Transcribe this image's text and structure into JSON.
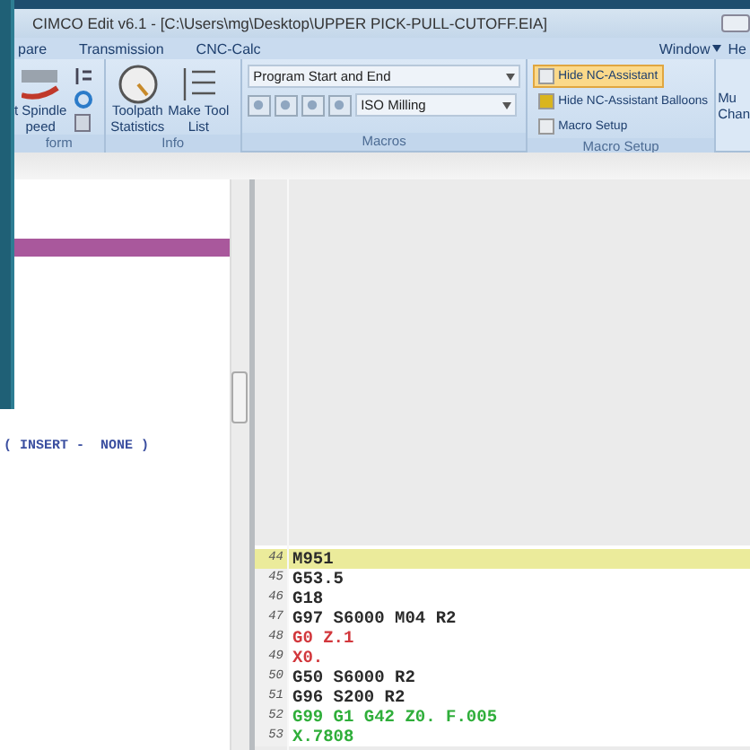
{
  "window": {
    "title": "CIMCO Edit v6.1 - [C:\\Users\\mg\\Desktop\\UPPER PICK-PULL-CUTOFF.EIA]"
  },
  "menu_tabs": [
    {
      "label": "pare"
    },
    {
      "label": "Transmission"
    },
    {
      "label": "CNC-Calc"
    }
  ],
  "menu_right": [
    {
      "label": "Window",
      "has_caret": true
    },
    {
      "label": "He",
      "has_caret": false
    }
  ],
  "ribbon": {
    "groups": [
      {
        "kind": "transform",
        "label": "form",
        "buttons": [
          {
            "label": "t Spindle\npeed"
          }
        ]
      },
      {
        "kind": "info",
        "label": "Info",
        "buttons": [
          {
            "label": "Toolpath\nStatistics"
          },
          {
            "label": "Make Tool\nList"
          }
        ]
      },
      {
        "kind": "macros",
        "label": "Macros",
        "dropdowns": [
          {
            "value": "Program Start and End"
          },
          {
            "value": "ISO Milling"
          }
        ]
      },
      {
        "kind": "macro_setup",
        "label": "Macro Setup",
        "items": [
          {
            "label": "Hide NC-Assistant",
            "selected": true
          },
          {
            "label": "Hide NC-Assistant Balloons",
            "selected": false
          },
          {
            "label": "Macro Setup",
            "selected": false
          }
        ]
      },
      {
        "kind": "cut",
        "label_lines": [
          "Mu",
          "Chan"
        ]
      }
    ]
  },
  "left_editor": {
    "text": "( INSERT -  NONE )"
  },
  "code_lines": [
    {
      "number": "44",
      "text": "M951",
      "kind": "plain",
      "current": true
    },
    {
      "number": "45",
      "text": "G53.5",
      "kind": "plain",
      "current": false
    },
    {
      "number": "46",
      "text": "G18",
      "kind": "plain",
      "current": false
    },
    {
      "number": "47",
      "text": "G97 S6000 M04 R2",
      "kind": "plain",
      "current": false
    },
    {
      "number": "48",
      "text": "G0 Z.1",
      "kind": "rapid",
      "current": false
    },
    {
      "number": "49",
      "text": "X0.",
      "kind": "rapid",
      "current": false
    },
    {
      "number": "50",
      "text": "G50 S6000 R2",
      "kind": "plain",
      "current": false
    },
    {
      "number": "51",
      "text": "G96 S200 R2",
      "kind": "plain",
      "current": false
    },
    {
      "number": "52",
      "text": "G99 G1 G42 Z0. F.005",
      "kind": "feed",
      "current": false
    },
    {
      "number": "53",
      "text": "X.7808",
      "kind": "feed",
      "current": false
    }
  ]
}
